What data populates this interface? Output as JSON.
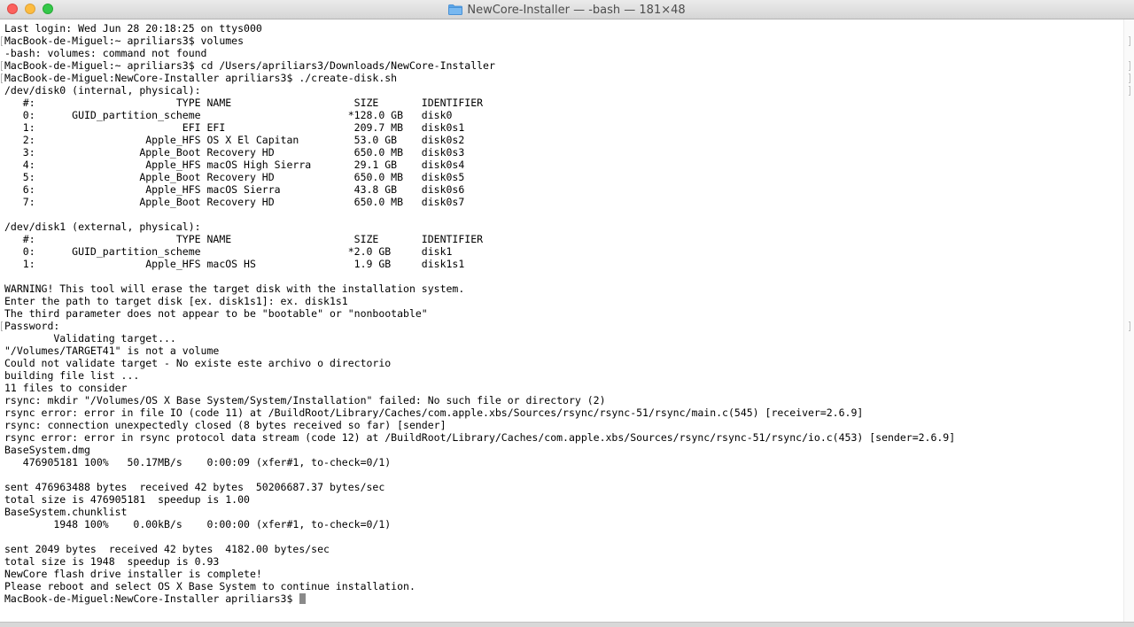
{
  "window": {
    "title": "NewCore-Installer — -bash — 181×48"
  },
  "icons": {
    "title_icon": "folder-icon",
    "close": "close-button",
    "minimize": "minimize-button",
    "zoom": "zoom-button"
  },
  "colors": {
    "close": "#fc615d",
    "minimize": "#fdbc40",
    "zoom": "#34c84a",
    "folder": "#5aa5e8",
    "terminal_bg": "#ffffff",
    "terminal_text": "#000000"
  },
  "terminal": {
    "lines": [
      "Last login: Wed Jun 28 20:18:25 on ttys000",
      "MacBook-de-Miguel:~ apriliars3$ volumes",
      "-bash: volumes: command not found",
      "MacBook-de-Miguel:~ apriliars3$ cd /Users/apriliars3/Downloads/NewCore-Installer",
      "MacBook-de-Miguel:NewCore-Installer apriliars3$ ./create-disk.sh",
      "/dev/disk0 (internal, physical):",
      "   #:                       TYPE NAME                    SIZE       IDENTIFIER",
      "   0:      GUID_partition_scheme                        *128.0 GB   disk0",
      "   1:                        EFI EFI                     209.7 MB   disk0s1",
      "   2:                  Apple_HFS OS X El Capitan         53.0 GB    disk0s2",
      "   3:                 Apple_Boot Recovery HD             650.0 MB   disk0s3",
      "   4:                  Apple_HFS macOS High Sierra       29.1 GB    disk0s4",
      "   5:                 Apple_Boot Recovery HD             650.0 MB   disk0s5",
      "   6:                  Apple_HFS macOS Sierra            43.8 GB    disk0s6",
      "   7:                 Apple_Boot Recovery HD             650.0 MB   disk0s7",
      "",
      "/dev/disk1 (external, physical):",
      "   #:                       TYPE NAME                    SIZE       IDENTIFIER",
      "   0:      GUID_partition_scheme                        *2.0 GB     disk1",
      "   1:                  Apple_HFS macOS HS                1.9 GB     disk1s1",
      "",
      "WARNING! This tool will erase the target disk with the installation system.",
      "Enter the path to target disk [ex. disk1s1]: ex. disk1s1",
      "The third parameter does not appear to be \"bootable\" or \"nonbootable\"",
      "Password:",
      "        Validating target...",
      "\"/Volumes/TARGET41\" is not a volume",
      "Could not validate target - No existe este archivo o directorio",
      "building file list ...",
      "11 files to consider",
      "rsync: mkdir \"/Volumes/OS X Base System/System/Installation\" failed: No such file or directory (2)",
      "rsync error: error in file IO (code 11) at /BuildRoot/Library/Caches/com.apple.xbs/Sources/rsync/rsync-51/rsync/main.c(545) [receiver=2.6.9]",
      "rsync: connection unexpectedly closed (8 bytes received so far) [sender]",
      "rsync error: error in rsync protocol data stream (code 12) at /BuildRoot/Library/Caches/com.apple.xbs/Sources/rsync/rsync-51/rsync/io.c(453) [sender=2.6.9]",
      "BaseSystem.dmg",
      "   476905181 100%   50.17MB/s    0:00:09 (xfer#1, to-check=0/1)",
      "",
      "sent 476963488 bytes  received 42 bytes  50206687.37 bytes/sec",
      "total size is 476905181  speedup is 1.00",
      "BaseSystem.chunklist",
      "        1948 100%    0.00kB/s    0:00:00 (xfer#1, to-check=0/1)",
      "",
      "sent 2049 bytes  received 42 bytes  4182.00 bytes/sec",
      "total size is 1948  speedup is 0.93",
      "NewCore flash drive installer is complete!",
      "Please reboot and select OS X Base System to continue installation.",
      "MacBook-de-Miguel:NewCore-Installer apriliars3$ "
    ]
  }
}
